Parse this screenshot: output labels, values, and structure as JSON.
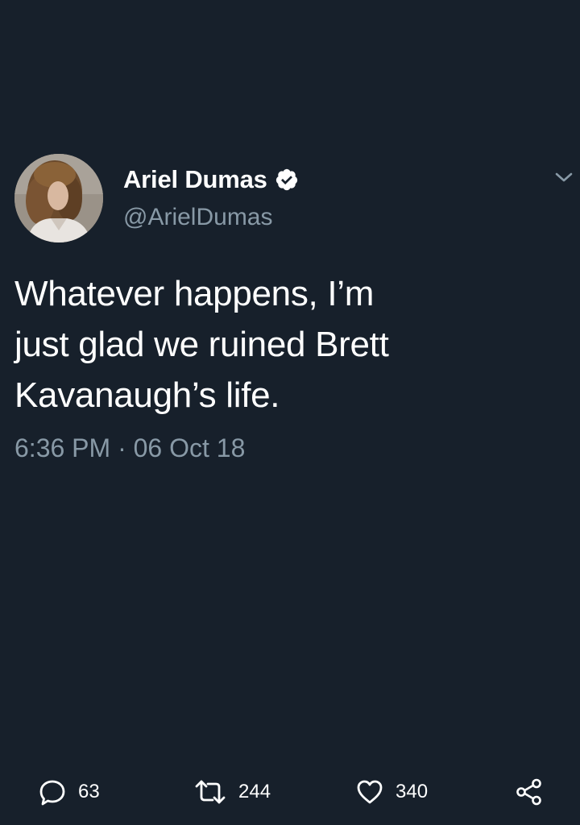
{
  "tweet": {
    "author": {
      "display_name": "Ariel Dumas",
      "handle": "@ArielDumas",
      "verified": true,
      "avatar_icon": "profile-photo"
    },
    "text_lines": [
      "Whatever happens, I’m",
      "just glad we ruined Brett",
      "Kavanaugh’s life."
    ],
    "timestamp": "6:36 PM · 06 Oct 18",
    "actions": {
      "replies": "63",
      "retweets": "244",
      "likes": "340"
    }
  },
  "colors": {
    "background": "#17202b",
    "primary_text": "#ffffff",
    "secondary_text": "#8899a6",
    "icon": "#8899a6"
  }
}
